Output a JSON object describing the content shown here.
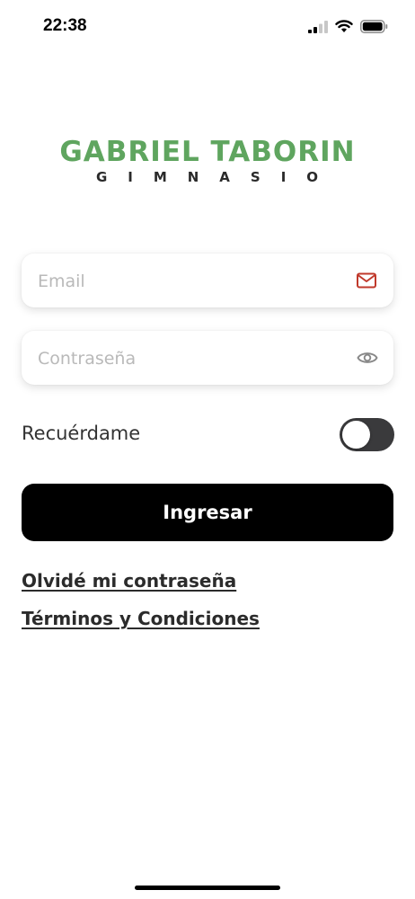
{
  "status_bar": {
    "time": "22:38"
  },
  "logo": {
    "title": "GABRIEL TABORIN",
    "subtitle": "GIMNASIO"
  },
  "form": {
    "email_placeholder": "Email",
    "email_value": "",
    "password_placeholder": "Contraseña",
    "password_value": "",
    "remember_label": "Recuérdame",
    "remember_on": false,
    "submit_label": "Ingresar"
  },
  "links": {
    "forgot_password": "Olvidé mi contraseña",
    "terms": "Términos y Condiciones"
  },
  "colors": {
    "logo_green": "#5fa55f",
    "mail_icon_red": "#c0392b",
    "button_bg": "#000000",
    "toggle_bg": "#3a3a3c"
  },
  "icons": {
    "email": "mail-icon",
    "password": "eye-icon",
    "signal": "signal-icon",
    "wifi": "wifi-icon",
    "battery": "battery-icon"
  }
}
